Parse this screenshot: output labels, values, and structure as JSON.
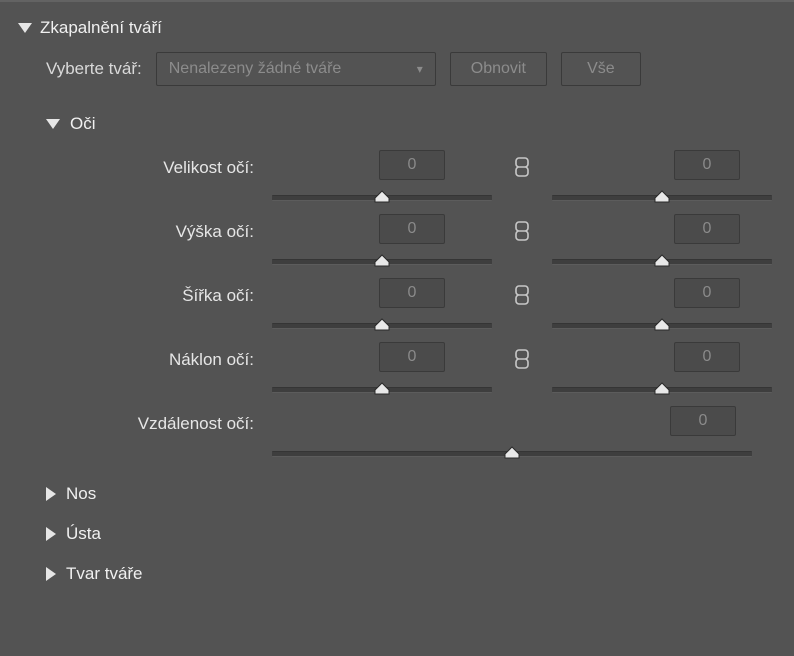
{
  "panel": {
    "title": "Zkapalnění tváří",
    "selectFace": {
      "label": "Vyberte tvář:",
      "selected": "Nenalezeny žádné tváře"
    },
    "buttons": {
      "reset": "Obnovit",
      "all": "Vše"
    },
    "sections": {
      "eyes": {
        "title": "Oči",
        "rows": {
          "size": {
            "label": "Velikost očí:",
            "left": "0",
            "right": "0"
          },
          "height": {
            "label": "Výška očí:",
            "left": "0",
            "right": "0"
          },
          "width": {
            "label": "Šířka očí:",
            "left": "0",
            "right": "0"
          },
          "tilt": {
            "label": "Náklon očí:",
            "left": "0",
            "right": "0"
          },
          "distance": {
            "label": "Vzdálenost očí:",
            "value": "0"
          }
        }
      },
      "nose": {
        "title": "Nos"
      },
      "mouth": {
        "title": "Ústa"
      },
      "shape": {
        "title": "Tvar tváře"
      }
    }
  }
}
